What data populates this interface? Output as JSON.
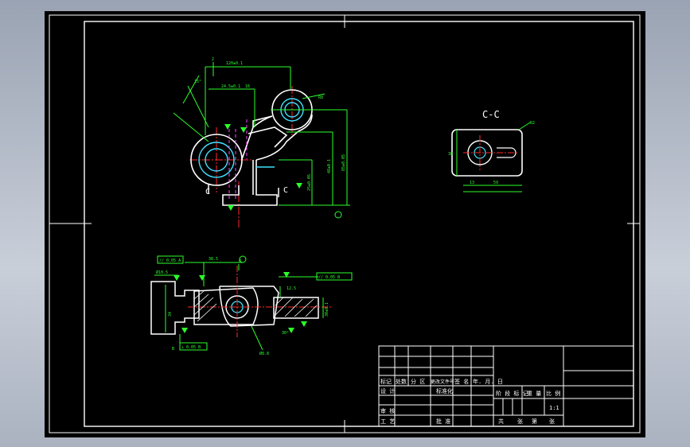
{
  "drawing": {
    "section_label": "C-C",
    "section_marker_left": "C",
    "section_marker_right": "C",
    "datum_b_top": "B",
    "datum_b_bottom": "B"
  },
  "dimensions": {
    "top_overall": "120±0.1",
    "top_left": "24.5±0.1",
    "top_mid": "16",
    "top_small": "2",
    "height_right_1": "85±0.05",
    "height_right_2": "48±0.1",
    "height_mid": "25±0.05",
    "radius_right": "R8",
    "angle_left": "15°",
    "section_width": "59",
    "section_sub": "13",
    "section_height": "38",
    "section_radius": "R2",
    "plan_width": "38.5",
    "plan_left_h": "34",
    "plan_right_h": "30±0.1",
    "plan_depth": "12.5",
    "plan_angle": "30°",
    "plan_hole": "Ø8.8",
    "plan_note": "Ø10.5",
    "tol_top": "// 0.05 A",
    "tol_right": "// 0.05 B",
    "tol_bottom": "⊥ 0.05 B"
  },
  "title_block": {
    "headers": [
      "标记",
      "处数",
      "分 区",
      "更改文件号",
      "签 名",
      "年. 月. 日"
    ],
    "row_design": [
      "设 计",
      "标准化"
    ],
    "row_stage": [
      "阶 段 标 记",
      "重 量",
      "比 例"
    ],
    "scale": "1:1",
    "row_review": "审 核",
    "row_process": [
      "工 艺",
      "批 准"
    ],
    "sheet_info": [
      "共",
      "张",
      "第",
      "张"
    ]
  }
}
